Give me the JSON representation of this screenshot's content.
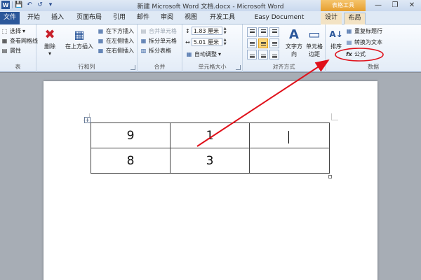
{
  "window": {
    "title": "新建 Microsoft Word 文档.docx - Microsoft Word",
    "context_tab_title": "表格工具",
    "minimize": "—",
    "restore": "❐",
    "close": "✕"
  },
  "qat": {
    "save": "💾",
    "undo": "↶",
    "redo": "↺",
    "more": "▾"
  },
  "tabs": [
    {
      "label": "文件"
    },
    {
      "label": "开始"
    },
    {
      "label": "插入"
    },
    {
      "label": "页面布局"
    },
    {
      "label": "引用"
    },
    {
      "label": "邮件"
    },
    {
      "label": "审阅"
    },
    {
      "label": "视图"
    },
    {
      "label": "开发工具"
    },
    {
      "label": "Easy Document Creator"
    },
    {
      "label": "设计"
    },
    {
      "label": "布局"
    }
  ],
  "ribbon": {
    "table_group": {
      "label": "表",
      "select": "选择",
      "gridlines": "查看网格线",
      "properties": "属性"
    },
    "rows_cols_group": {
      "label": "行和列",
      "delete": "删除",
      "insert_above": "在上方插入",
      "insert_below": "在下方插入",
      "insert_left": "在左侧插入",
      "insert_right": "在右侧插入"
    },
    "merge_group": {
      "label": "合并",
      "merge_cells": "合并单元格",
      "split_cells": "拆分单元格",
      "split_table": "拆分表格"
    },
    "cell_size_group": {
      "label": "单元格大小",
      "height": "1.83 厘米",
      "width": "5.01 厘米",
      "autofit": "自动调整"
    },
    "alignment_group": {
      "label": "对齐方式",
      "text_direction": "文字方向",
      "cell_margins": "单元格\n边距"
    },
    "data_group": {
      "label": "数据",
      "sort": "排序",
      "repeat_header": "重复标题行",
      "convert_text": "转换为文本",
      "formula": "公式"
    }
  },
  "table": {
    "rows": [
      [
        "9",
        "1",
        ""
      ],
      [
        "8",
        "3",
        ""
      ]
    ]
  },
  "icons": {
    "delete": "✖",
    "formula": "fx",
    "sort": "A↓",
    "text_direction": "A",
    "cell_margins": "▭",
    "select": "⬚",
    "gridlines": "▦",
    "properties": "▤",
    "table_move": "+"
  },
  "colors": {
    "file_tab": "#2b579a",
    "context_tab": "#f0a63c",
    "annotation": "#e0101a"
  }
}
